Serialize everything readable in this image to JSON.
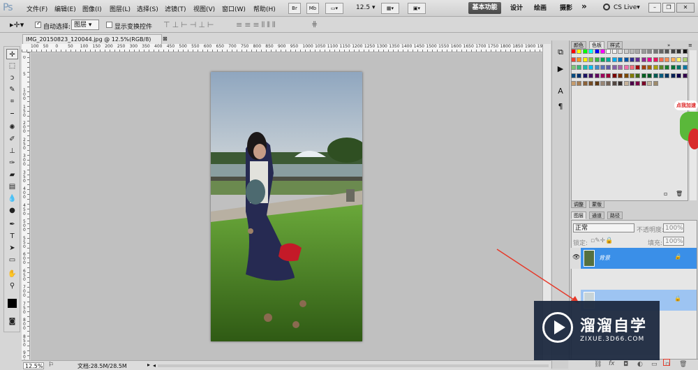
{
  "app": {
    "logo": "Ps",
    "menu": [
      "文件(F)",
      "编辑(E)",
      "图像(I)",
      "图层(L)",
      "选择(S)",
      "滤镜(T)",
      "视图(V)",
      "窗口(W)",
      "帮助(H)"
    ],
    "toolbar_buttons": [
      "Br",
      "Mb"
    ],
    "zoom_dropdown": "12.5",
    "workspaces": {
      "active": "基本功能",
      "others": [
        "设计",
        "绘画",
        "摄影"
      ],
      "more": "»"
    },
    "cs_live": "CS Live▾"
  },
  "options": {
    "auto_select_label": "自动选择:",
    "auto_select_value": "图层",
    "show_transform_label": "显示变换控件"
  },
  "document": {
    "tab_title": "IMG_20150823_120044.jpg @ 12.5%(RGB/8)",
    "zoom_status": "12.5%",
    "doc_size": "文档:28.5M/28.5M"
  },
  "ruler": {
    "h_labels": [
      "100",
      "50",
      "0",
      "50",
      "100",
      "150",
      "200",
      "250",
      "300",
      "350",
      "400",
      "450",
      "500",
      "550",
      "600",
      "650",
      "700",
      "750",
      "800",
      "850",
      "900",
      "950",
      "1000",
      "1050",
      "1100",
      "1150",
      "1200",
      "1250",
      "1300",
      "1350",
      "1400",
      "1450",
      "1500",
      "1550",
      "1600",
      "1650",
      "1700",
      "1750",
      "1800",
      "1850",
      "1900",
      "1950"
    ],
    "v_labels": [
      "0",
      "5",
      "1 0 0",
      "1 5 0",
      "2 0 0",
      "2 5 0",
      "3 0 0",
      "3 5 0",
      "4 0 0",
      "4 5 0",
      "5 0 0",
      "5 5 0",
      "6 0 0",
      "6 5 0",
      "7 0 0",
      "7 5 0",
      "8 0 0",
      "8 5 0",
      "9 0 0"
    ]
  },
  "color_panel": {
    "tabs": [
      "颜色",
      "色板",
      "样式"
    ],
    "active_tab": "色板"
  },
  "layers_panel": {
    "top_tabs": [
      "调整",
      "蒙版"
    ],
    "tabs": [
      "图层",
      "通道",
      "路径"
    ],
    "blend_mode": "正常",
    "opacity_label": "不透明度:",
    "opacity_value": "100%",
    "lock_label": "锁定:",
    "fill_label": "填充:",
    "fill_value": "100%",
    "layer_name": "背景"
  },
  "badges": {
    "click_join": "点我加速"
  },
  "watermark": {
    "title": "溜溜自学",
    "url": "ZIXUE.3D66.COM"
  },
  "colors": {
    "accent_blue": "#3a8fe8",
    "watermark_bg": "#1d2a40",
    "arrow_red": "#e63a2a"
  }
}
